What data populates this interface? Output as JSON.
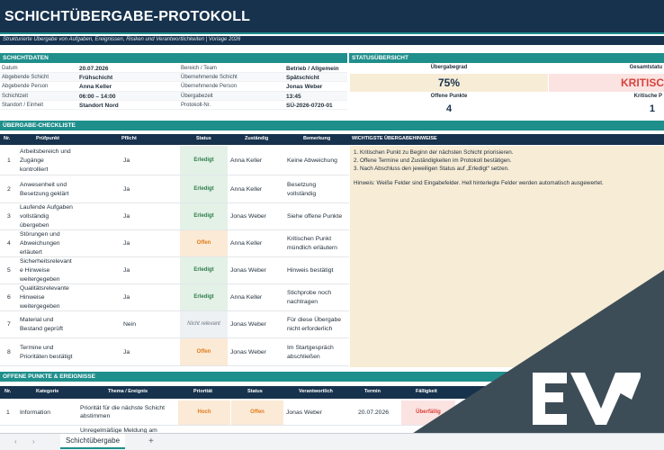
{
  "header": {
    "title": "SCHICHTÜBERGABE-PROTOKOLL",
    "subtitle": "Strukturierte Übergabe von Aufgaben, Ereignissen, Risiken und Verantwortlichkeiten | Vorlage 2026"
  },
  "schichtdaten": {
    "section_title": "SCHICHTDATEN",
    "rows": [
      {
        "label_a": "Datum",
        "value_a": "20.07.2026",
        "label_b": "Bereich / Team",
        "value_b": "Betrieb / Allgemein"
      },
      {
        "label_a": "Abgebende Schicht",
        "value_a": "Frühschicht",
        "label_b": "Übernehmende Schicht",
        "value_b": "Spätschicht"
      },
      {
        "label_a": "Abgebende Person",
        "value_a": "Anna Keller",
        "label_b": "Übernehmende Person",
        "value_b": "Jonas Weber"
      },
      {
        "label_a": "Schichtzeit",
        "value_a": "06:00 – 14:00",
        "label_b": "Übergabezeit",
        "value_b": "13:45"
      },
      {
        "label_a": "Standort / Einheit",
        "value_a": "Standort Nord",
        "label_b": "Protokoll-Nr.",
        "value_b": "SÜ-2026-0720-01"
      }
    ]
  },
  "status": {
    "section_title": "STATUSÜBERSICHT",
    "uebergabegrad_label": "Übergabegrad",
    "uebergabegrad_value": "75%",
    "gesamtstatus_label": "Gesamtstatu",
    "gesamtstatus_value": "KRITISC",
    "offene_label": "Offene Punkte",
    "offene_value": "4",
    "kritische_label": "Kritische P",
    "kritische_value": "1",
    "colors": {
      "critical": "#d9423b",
      "critical_bg": "#fbe3e2",
      "neutral_bg": "#f7ecd6"
    }
  },
  "checklist": {
    "section_title": "ÜBERGABE-CHECKLISTE",
    "columns": [
      "Nr.",
      "Prüfpunkt",
      "Pflicht",
      "Status",
      "Zuständig",
      "Bemerkung"
    ],
    "rows": [
      {
        "nr": "1",
        "punkt": [
          "Arbeitsbereich und",
          "Zugänge",
          "kontrolliert"
        ],
        "pflicht": "Ja",
        "status": "Erledigt",
        "zustaendig": "Anna Keller",
        "bemerkung": [
          "Keine Abweichung"
        ]
      },
      {
        "nr": "2",
        "punkt": [
          "Anwesenheit und",
          "Besetzung geklärt"
        ],
        "pflicht": "Ja",
        "status": "Erledigt",
        "zustaendig": "Anna Keller",
        "bemerkung": [
          "Besetzung",
          "vollständig"
        ]
      },
      {
        "nr": "3",
        "punkt": [
          "Laufende Aufgaben",
          "vollständig",
          "übergeben"
        ],
        "pflicht": "Ja",
        "status": "Erledigt",
        "zustaendig": "Jonas Weber",
        "bemerkung": [
          "Siehe offene Punkte"
        ]
      },
      {
        "nr": "4",
        "punkt": [
          "Störungen und",
          "Abweichungen",
          "erläutert"
        ],
        "pflicht": "Ja",
        "status": "Offen",
        "zustaendig": "Anna Keller",
        "bemerkung": [
          "Kritischen Punkt",
          "mündlich erläutern"
        ]
      },
      {
        "nr": "5",
        "punkt": [
          "Sicherheitsrelevant",
          "e Hinweise",
          "weitergegeben"
        ],
        "pflicht": "Ja",
        "status": "Erledigt",
        "zustaendig": "Jonas Weber",
        "bemerkung": [
          "Hinweis bestätigt"
        ]
      },
      {
        "nr": "6",
        "punkt": [
          "Qualitätsrelevante",
          "Hinweise",
          "weitergegeben"
        ],
        "pflicht": "Ja",
        "status": "Erledigt",
        "zustaendig": "Anna Keller",
        "bemerkung": [
          "Stichprobe noch",
          "nachtragen"
        ]
      },
      {
        "nr": "7",
        "punkt": [
          "Material und",
          "Bestand geprüft"
        ],
        "pflicht": "Nein",
        "status": "Nicht relevant",
        "zustaendig": "Jonas Weber",
        "bemerkung": [
          "Für diese Übergabe",
          "nicht erforderlich"
        ]
      },
      {
        "nr": "8",
        "punkt": [
          "Termine und",
          "Prioritäten bestätigt"
        ],
        "pflicht": "Ja",
        "status": "Offen",
        "zustaendig": "Jonas Weber",
        "bemerkung": [
          "Im Startgespräch",
          "abschließen"
        ]
      }
    ]
  },
  "hinweise": {
    "title": "WICHTIGSTE ÜBERGABEHINWEISE",
    "lines": [
      "1. Kritischen Punkt zu Beginn der nächsten Schicht priorisieren.",
      "2. Offene Termine und Zuständigkeiten im Protokoll bestätigen.",
      "3. Nach Abschluss den jeweiligen Status auf „Erledigt“ setzen.",
      "Hinweis: Weiße Felder sind Eingabefelder. Hell hinterlegte Felder werden automatisch ausgewertet."
    ]
  },
  "offene_punkte": {
    "section_title": "OFFENE PUNKTE & EREIGNISSE",
    "columns": [
      "Nr.",
      "Kategorie",
      "Thema / Ereignis",
      "Priorität",
      "Status",
      "Verantwortlich",
      "Termin",
      "Fälligkeit"
    ],
    "rows": [
      {
        "nr": "1",
        "kategorie": "Information",
        "thema": [
          "Priorität für die nächste Schicht",
          "abstimmen"
        ],
        "prioritaet": "Hoch",
        "status": "Offen",
        "verantwortlich": "Jonas Weber",
        "termin": "20.07.2026",
        "faelligkeit": "Überfällig"
      },
      {
        "nr": "",
        "kategorie": "",
        "thema": [
          "Unregelmäßige Meldung am"
        ],
        "prioritaet": "",
        "status": "",
        "verantwortlich": "",
        "termin": "",
        "faelligkeit": ""
      }
    ]
  },
  "tabs": {
    "sheet_name": "Schichtübergabe",
    "add_label": "+",
    "prev_label": "‹",
    "next_label": "›"
  },
  "colors": {
    "navy": "#17324d",
    "teal": "#1f8f8c",
    "ok": "#2e7d4a",
    "open": "#e07b1a",
    "overdue": "#d9423b"
  }
}
